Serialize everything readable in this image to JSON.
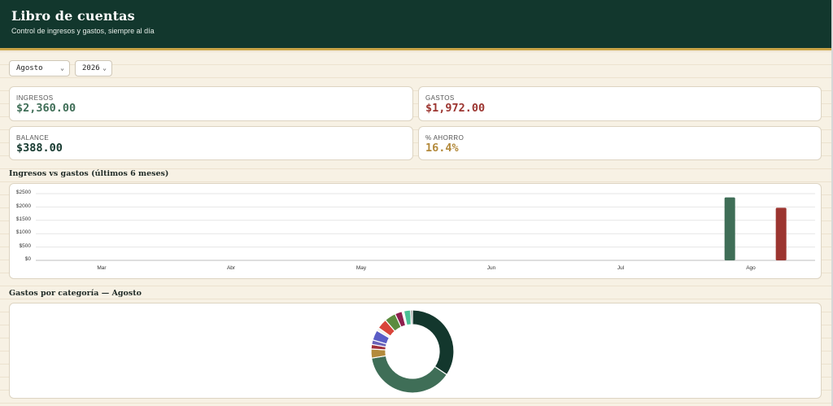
{
  "header": {
    "title": "Libro de cuentas",
    "subtitle": "Control de ingresos y gastos, siempre al día"
  },
  "filters": {
    "month": "Agosto",
    "year": "2026"
  },
  "stats": [
    {
      "label": "INGRESOS",
      "value": "$2,360.00",
      "color": "#3f6e57"
    },
    {
      "label": "GASTOS",
      "value": "$1,972.00",
      "color": "#9c3530"
    },
    {
      "label": "BALANCE",
      "value": "$388.00",
      "color": "#173a30"
    },
    {
      "label": "% AHORRO",
      "value": "16.4%",
      "color": "#b38a3c"
    }
  ],
  "sections": {
    "bar_title": "Ingresos vs gastos (últimos 6 meses)",
    "donut_title": "Gastos por categoría — Agosto"
  },
  "chart_data": [
    {
      "type": "bar",
      "categories": [
        "Mar",
        "Abr",
        "May",
        "Jun",
        "Jul",
        "Ago"
      ],
      "series": [
        {
          "values": [
            0,
            0,
            0,
            0,
            0,
            2360
          ],
          "color": "#3f6e57"
        },
        {
          "values": [
            0,
            0,
            0,
            0,
            0,
            1972
          ],
          "color": "#9c3530"
        }
      ],
      "ylim": [
        0,
        2500
      ],
      "yticks": [
        "$2500",
        "$2000",
        "$1500",
        "$1000",
        "$500",
        "$0"
      ],
      "grid": true
    },
    {
      "type": "pie",
      "values": [
        390,
        430,
        40,
        20,
        20,
        45,
        14,
        45,
        50,
        32,
        8,
        30,
        8
      ],
      "colors": [
        "#13372d",
        "#3f6e57",
        "#b38a3c",
        "#a02f3a",
        "#6a62b8",
        "#5a5dc6",
        "#f2efe6",
        "#d9453a",
        "#5c8c3f",
        "#8f1f4e",
        "#f0f0ea",
        "#4bc095",
        "#7a7a7a"
      ]
    }
  ]
}
